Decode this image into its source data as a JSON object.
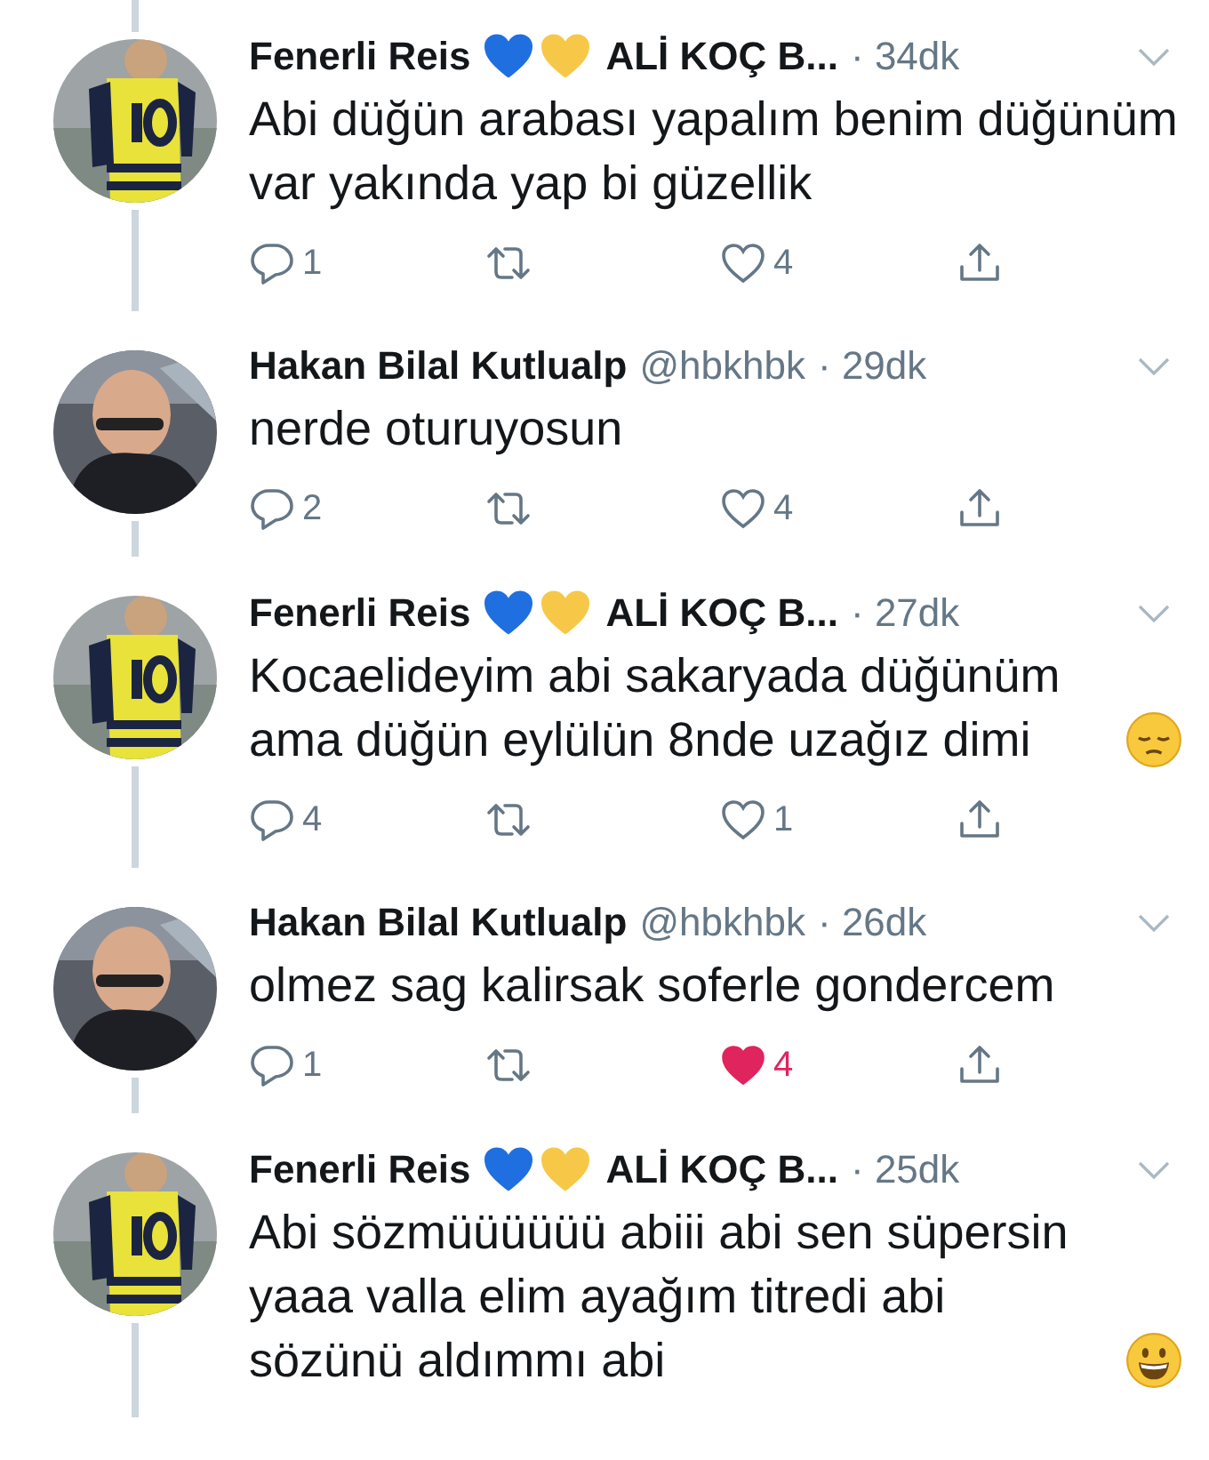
{
  "tweets": [
    {
      "name": "Fenerli Reis",
      "hearts": [
        {
          "color": "#1f6fe0"
        },
        {
          "color": "#f7c847"
        }
      ],
      "name_suffix": "ALİ KOÇ B...",
      "time": "· 34dk",
      "text": "Abi düğün arabası yapalım benim düğünüm var yakında yap bi güzellik",
      "replies": "1",
      "likes": "4",
      "liked": false
    },
    {
      "name": "Hakan Bilal Kutlualp",
      "handle": "@hbkhbk",
      "time": "· 29dk",
      "text": "nerde oturuyosun",
      "replies": "2",
      "likes": "4",
      "liked": false
    },
    {
      "name": "Fenerli Reis",
      "hearts": [
        {
          "color": "#1f6fe0"
        },
        {
          "color": "#f7c847"
        }
      ],
      "name_suffix": "ALİ KOÇ B...",
      "time": "· 27dk",
      "text": "Kocaelideyim abi sakaryada düğünüm ama düğün eylülün 8nde uzağız dimi",
      "trailing_icon": {
        "kind": "pensive"
      },
      "replies": "4",
      "likes": "1",
      "liked": false
    },
    {
      "name": "Hakan Bilal Kutlualp",
      "handle": "@hbkhbk",
      "time": "· 26dk",
      "text": "olmez sag kalirsak soferle gondercem",
      "replies": "1",
      "likes": "4",
      "liked": true
    },
    {
      "name": "Fenerli Reis",
      "hearts": [
        {
          "color": "#1f6fe0"
        },
        {
          "color": "#f7c847"
        }
      ],
      "name_suffix": "ALİ KOÇ B...",
      "time": "· 25dk",
      "text": "Abi sözmüüüüüü abiii abi sen süpersin yaaa valla elim ayağım titredi abi sözünü aldımmı abi",
      "trailing_icon": {
        "kind": "grinning"
      }
    }
  ]
}
